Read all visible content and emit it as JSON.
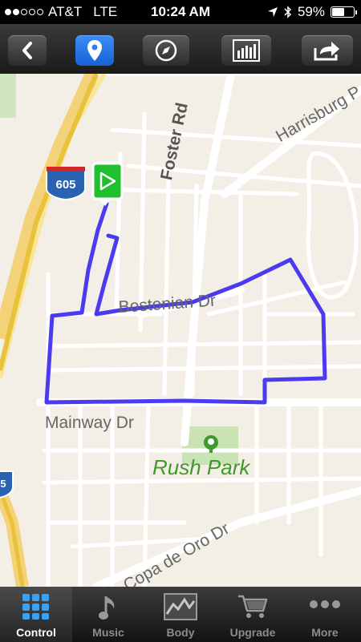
{
  "status_bar": {
    "carrier": "AT&T",
    "network": "LTE",
    "time": "10:24 AM",
    "battery": "59%",
    "battery_level": 0.59,
    "signal_bars": 2
  },
  "toolbar": {
    "buttons": [
      {
        "name": "back",
        "icon": "chevron-left-icon",
        "active": false
      },
      {
        "name": "map-marker",
        "icon": "map-pin-icon",
        "active": true
      },
      {
        "name": "compass",
        "icon": "compass-icon",
        "active": false
      },
      {
        "name": "stats",
        "icon": "bar-chart-icon",
        "active": false
      },
      {
        "name": "share",
        "icon": "share-arrow-icon",
        "active": false
      }
    ],
    "accent_color": "#2f7fee"
  },
  "map": {
    "streets": {
      "foster": "Foster Rd",
      "harrisburg": "Harrisburg P",
      "bostonian": "Bostonian Dr",
      "mainway": "Mainway Dr",
      "copa": "Copa de Oro Dr"
    },
    "park": "Rush Park",
    "highway_shields": [
      "605",
      "5"
    ],
    "route_color": "#4a3af0",
    "start_marker_color": "#1fbf2e"
  },
  "tabbar": {
    "tabs": [
      {
        "label": "Control",
        "icon": "grid-icon",
        "active": true
      },
      {
        "label": "Music",
        "icon": "music-note-icon",
        "active": false
      },
      {
        "label": "Body",
        "icon": "body-chart-icon",
        "active": false
      },
      {
        "label": "Upgrade",
        "icon": "cart-icon",
        "active": false
      },
      {
        "label": "More",
        "icon": "more-dots-icon",
        "active": false
      }
    ]
  }
}
